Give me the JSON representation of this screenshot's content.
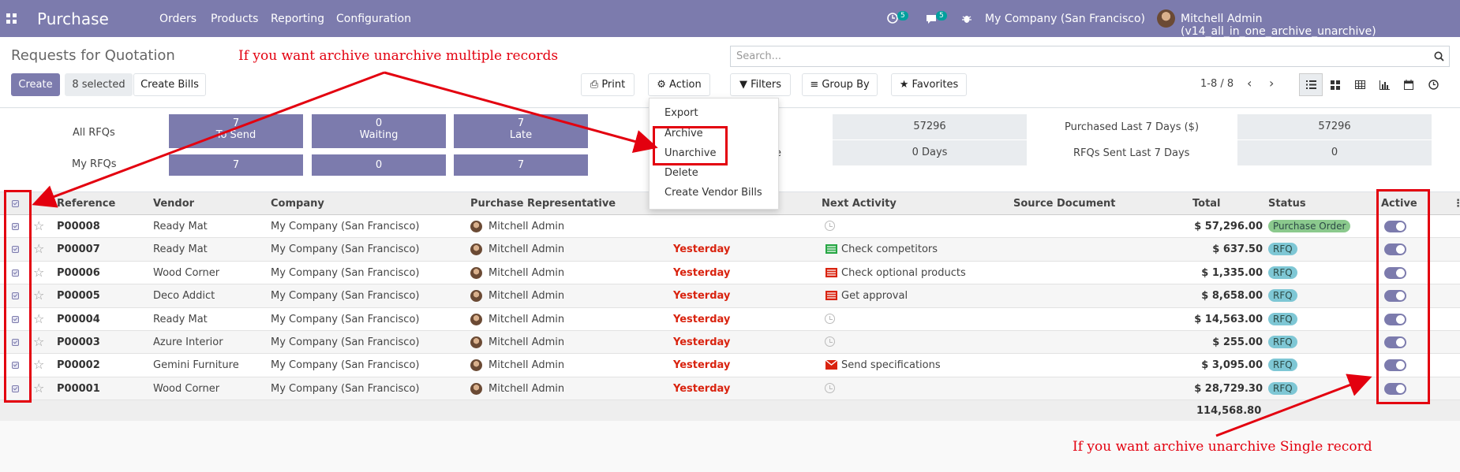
{
  "navbar": {
    "app_name": "Purchase",
    "menu": [
      "Orders",
      "Products",
      "Reporting",
      "Configuration"
    ],
    "activity_count": "5",
    "message_count": "5",
    "company": "My Company (San Francisco)",
    "user": "Mitchell Admin (v14_all_in_one_archive_unarchive)"
  },
  "control_panel": {
    "breadcrumb": "Requests for Quotation",
    "create_label": "Create",
    "selected_label": "8 selected",
    "create_bills_label": "Create Bills",
    "print_label": "Print",
    "action_label": "Action",
    "search_placeholder": "Search...",
    "filters_label": "Filters",
    "group_by_label": "Group By",
    "favorites_label": "Favorites",
    "pager": "1-8 / 8"
  },
  "dashboard": {
    "all_rfqs_label": "All RFQs",
    "my_rfqs_label": "My RFQs",
    "tiles": [
      {
        "count": "7",
        "label": "To Send"
      },
      {
        "count": "0",
        "label": "Waiting"
      },
      {
        "count": "7",
        "label": "Late"
      }
    ],
    "my_values": [
      "7",
      "0",
      "7"
    ],
    "mid_value_1": "57296",
    "mid_label_2_suffix": "e",
    "mid_value_2": "0  Days",
    "purchased_label": "Purchased Last 7 Days ($)",
    "purchased_value": "57296",
    "rfqs_sent_label": "RFQs Sent Last 7 Days",
    "rfqs_sent_value": "0"
  },
  "action_menu": [
    "Export",
    "Archive",
    "Unarchive",
    "Delete",
    "Create Vendor Bills"
  ],
  "table": {
    "headers": [
      "Reference",
      "Vendor",
      "Company",
      "Purchase Representative",
      "Next Activity",
      "Source Document",
      "Total",
      "Status",
      "Active"
    ],
    "rows": [
      {
        "ref": "P00008",
        "vendor": "Ready Mat",
        "company": "My Company (San Francisco)",
        "rep": "Mitchell Admin",
        "deadline": "",
        "activity": "",
        "activity_icon": "clock",
        "total": "$ 57,296.00",
        "status": "Purchase Order"
      },
      {
        "ref": "P00007",
        "vendor": "Ready Mat",
        "company": "My Company (San Francisco)",
        "rep": "Mitchell Admin",
        "deadline": "Yesterday",
        "activity": "Check competitors",
        "activity_icon": "list-green",
        "total": "$ 637.50",
        "status": "RFQ"
      },
      {
        "ref": "P00006",
        "vendor": "Wood Corner",
        "company": "My Company (San Francisco)",
        "rep": "Mitchell Admin",
        "deadline": "Yesterday",
        "activity": "Check optional products",
        "activity_icon": "list-red",
        "total": "$ 1,335.00",
        "status": "RFQ"
      },
      {
        "ref": "P00005",
        "vendor": "Deco Addict",
        "company": "My Company (San Francisco)",
        "rep": "Mitchell Admin",
        "deadline": "Yesterday",
        "activity": "Get approval",
        "activity_icon": "list-red",
        "total": "$ 8,658.00",
        "status": "RFQ"
      },
      {
        "ref": "P00004",
        "vendor": "Ready Mat",
        "company": "My Company (San Francisco)",
        "rep": "Mitchell Admin",
        "deadline": "Yesterday",
        "activity": "",
        "activity_icon": "clock",
        "total": "$ 14,563.00",
        "status": "RFQ"
      },
      {
        "ref": "P00003",
        "vendor": "Azure Interior",
        "company": "My Company (San Francisco)",
        "rep": "Mitchell Admin",
        "deadline": "Yesterday",
        "activity": "",
        "activity_icon": "clock",
        "total": "$ 255.00",
        "status": "RFQ"
      },
      {
        "ref": "P00002",
        "vendor": "Gemini Furniture",
        "company": "My Company (San Francisco)",
        "rep": "Mitchell Admin",
        "deadline": "Yesterday",
        "activity": "Send specifications",
        "activity_icon": "envelope-red",
        "total": "$ 3,095.00",
        "status": "RFQ"
      },
      {
        "ref": "P00001",
        "vendor": "Wood Corner",
        "company": "My Company (San Francisco)",
        "rep": "Mitchell Admin",
        "deadline": "Yesterday",
        "activity": "",
        "activity_icon": "clock",
        "total": "$ 28,729.30",
        "status": "RFQ"
      }
    ],
    "grand_total": "114,568.80"
  },
  "annotations": {
    "multiple": "If you want archive unarchive multiple records",
    "single": "If you want archive unarchive Single record"
  },
  "colors": {
    "brand": "#7c7bad",
    "annotation": "#e3000f",
    "late": "#d9230f"
  }
}
